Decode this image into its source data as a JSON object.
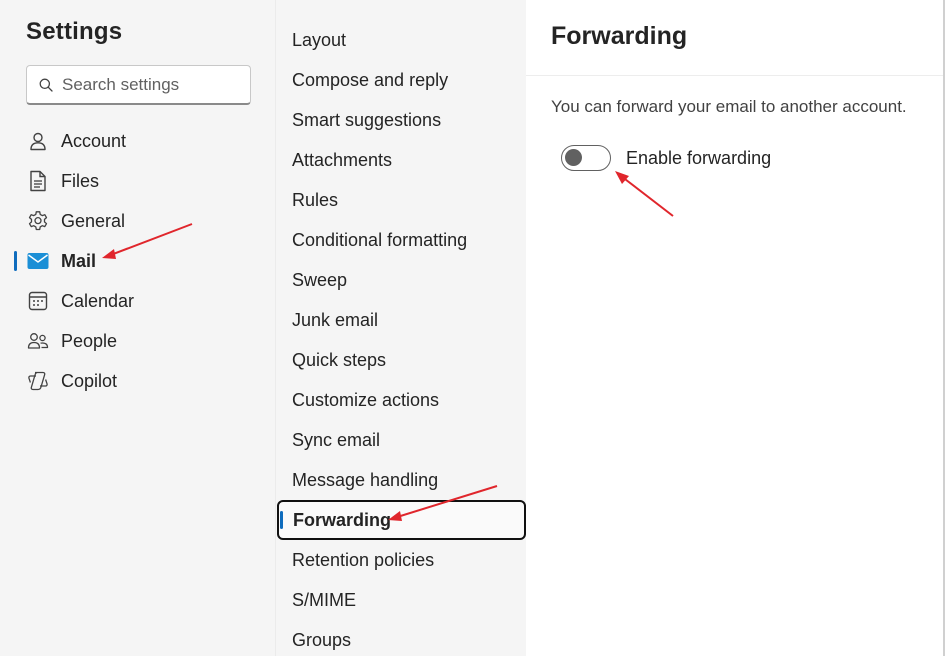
{
  "left": {
    "title": "Settings",
    "search": {
      "placeholder": "Search settings",
      "value": ""
    },
    "nav": [
      {
        "label": "Account",
        "icon": "person-icon",
        "selected": false
      },
      {
        "label": "Files",
        "icon": "file-icon",
        "selected": false
      },
      {
        "label": "General",
        "icon": "gear-icon",
        "selected": false
      },
      {
        "label": "Mail",
        "icon": "mail-icon",
        "selected": true
      },
      {
        "label": "Calendar",
        "icon": "calendar-icon",
        "selected": false
      },
      {
        "label": "People",
        "icon": "people-icon",
        "selected": false
      },
      {
        "label": "Copilot",
        "icon": "copilot-icon",
        "selected": false
      }
    ]
  },
  "middle": {
    "items": [
      {
        "label": "Layout",
        "selected": false
      },
      {
        "label": "Compose and reply",
        "selected": false
      },
      {
        "label": "Smart suggestions",
        "selected": false
      },
      {
        "label": "Attachments",
        "selected": false
      },
      {
        "label": "Rules",
        "selected": false
      },
      {
        "label": "Conditional formatting",
        "selected": false
      },
      {
        "label": "Sweep",
        "selected": false
      },
      {
        "label": "Junk email",
        "selected": false
      },
      {
        "label": "Quick steps",
        "selected": false
      },
      {
        "label": "Customize actions",
        "selected": false
      },
      {
        "label": "Sync email",
        "selected": false
      },
      {
        "label": "Message handling",
        "selected": false
      },
      {
        "label": "Forwarding",
        "selected": true
      },
      {
        "label": "Retention policies",
        "selected": false
      },
      {
        "label": "S/MIME",
        "selected": false
      },
      {
        "label": "Groups",
        "selected": false
      }
    ]
  },
  "right": {
    "title": "Forwarding",
    "description": "You can forward your email to another account.",
    "toggle": {
      "label": "Enable forwarding",
      "on": false
    }
  },
  "colors": {
    "accent": "#0f6cbd",
    "mail_icon": "#1b8fd6",
    "annotation_arrow": "#e0262c"
  }
}
